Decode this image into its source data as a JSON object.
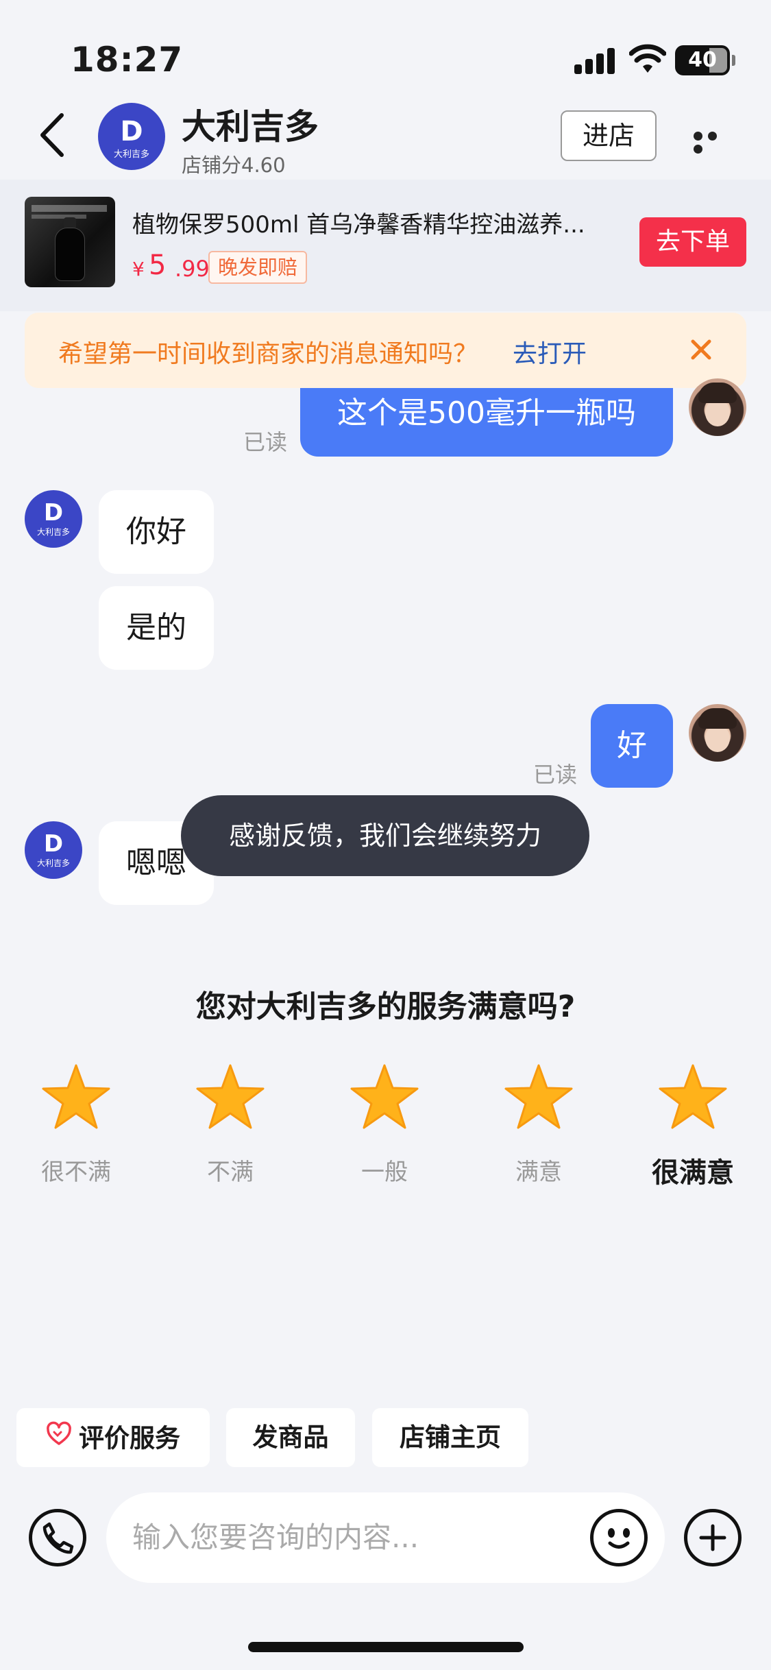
{
  "status": {
    "time": "18:27",
    "battery": "40"
  },
  "header": {
    "shop_name": "大利吉多",
    "shop_score": "店铺分4.60",
    "enter_label": "进店",
    "avatar_letter": "D",
    "avatar_text": "大利吉多"
  },
  "product": {
    "title": "植物保罗500ml 首乌净馨香精华控油滋养...",
    "currency": "¥",
    "price_int": "5",
    "price_dec": ".99",
    "tag": "晚发即赔",
    "order_label": "去下单"
  },
  "notice": {
    "text": "希望第一时间收到商家的消息通知吗？",
    "link": "去打开"
  },
  "messages": [
    {
      "from": "user",
      "text": "这个是500毫升一瓶吗",
      "status": "已读"
    },
    {
      "from": "shop",
      "text": "你好"
    },
    {
      "from": "shop",
      "text": "是的"
    },
    {
      "from": "user",
      "text": "好",
      "status": "已读"
    },
    {
      "from": "shop",
      "text": "嗯嗯"
    }
  ],
  "toast": "感谢反馈，我们会继续努力",
  "rating": {
    "question": "您对大利吉多的服务满意吗?",
    "options": [
      "很不满",
      "不满",
      "一般",
      "满意",
      "很满意"
    ],
    "selected": 5,
    "star_color": "#ffb21a"
  },
  "quick_actions": [
    "评价服务",
    "发商品",
    "店铺主页"
  ],
  "input": {
    "placeholder": "输入您要咨询的内容..."
  },
  "colors": {
    "accent": "#4a7bf7",
    "price": "#f22945",
    "order_button": "#f4304a",
    "notice_bg": "#fff1e0"
  }
}
